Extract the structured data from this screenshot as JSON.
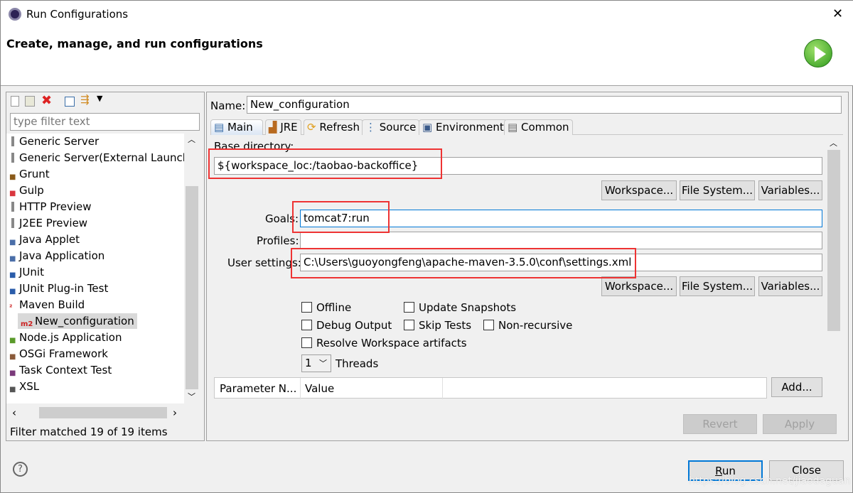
{
  "window": {
    "title": "Run Configurations",
    "close_glyph": "✕"
  },
  "header": {
    "title": "Create, manage, and run configurations"
  },
  "left": {
    "filter_placeholder": "type filter text",
    "items": [
      {
        "label": "Generic Server",
        "icon": "server-icon",
        "color": "#888888"
      },
      {
        "label": "Generic Server(External Launch)",
        "icon": "server-icon",
        "color": "#888888"
      },
      {
        "label": "Grunt",
        "icon": "grunt-icon",
        "color": "#8a5a1a"
      },
      {
        "label": "Gulp",
        "icon": "gulp-icon",
        "color": "#d9363e"
      },
      {
        "label": "HTTP Preview",
        "icon": "server-icon",
        "color": "#888888"
      },
      {
        "label": "J2EE Preview",
        "icon": "server-icon",
        "color": "#888888"
      },
      {
        "label": "Java Applet",
        "icon": "applet-icon",
        "color": "#4a6ea8"
      },
      {
        "label": "Java Application",
        "icon": "java-app-icon",
        "color": "#4a6ea8"
      },
      {
        "label": "JUnit",
        "icon": "junit-icon",
        "color": "#2a5caa"
      },
      {
        "label": "JUnit Plug-in Test",
        "icon": "junit-plugin-icon",
        "color": "#2a5caa"
      },
      {
        "label": "Maven Build",
        "icon": "maven-icon",
        "color": "#cc2222"
      },
      {
        "label": "New_configuration",
        "icon": "maven-icon",
        "color": "#cc2222",
        "child": true,
        "selected": true
      },
      {
        "label": "Node.js Application",
        "icon": "nodejs-icon",
        "color": "#5a9a2a"
      },
      {
        "label": "OSGi Framework",
        "icon": "osgi-icon",
        "color": "#8a5a3a"
      },
      {
        "label": "Task Context Test",
        "icon": "task-icon",
        "color": "#7a3a7a"
      },
      {
        "label": "XSL",
        "icon": "xsl-icon",
        "color": "#555555"
      }
    ],
    "status": "Filter matched 19 of 19 items"
  },
  "form": {
    "name_label": "Name:",
    "name_value": "New_configuration",
    "tabs": [
      "Main",
      "JRE",
      "Refresh",
      "Source",
      "Environment",
      "Common"
    ],
    "base_dir_label": "Base directory:",
    "base_dir_value": "${workspace_loc:/taobao-backoffice}",
    "workspace_btn": "Workspace...",
    "filesystem_btn": "File System...",
    "variables_btn": "Variables...",
    "goals_label": "Goals:",
    "goals_value": "tomcat7:run",
    "profiles_label": "Profiles:",
    "profiles_value": "",
    "user_settings_label": "User settings:",
    "user_settings_value": "C:\\Users\\guoyongfeng\\apache-maven-3.5.0\\conf\\settings.xml",
    "checkboxes": {
      "offline": "Offline",
      "update_snapshots": "Update Snapshots",
      "debug_output": "Debug Output",
      "skip_tests": "Skip Tests",
      "non_recursive": "Non-recursive",
      "resolve_workspace": "Resolve Workspace artifacts"
    },
    "threads_value": "1",
    "threads_label": "Threads",
    "param_col1": "Parameter N...",
    "param_col2": "Value",
    "add_btn": "Add...",
    "revert_btn": "Revert",
    "apply_btn": "Apply"
  },
  "footer": {
    "help": "?",
    "run": "Run",
    "close": "Close",
    "watermark": "https://blog.csdn.net/jiaodaguan"
  },
  "colors": {
    "accent": "#0078d7",
    "highlight": "#ee3333",
    "selected": "#d9d9d9"
  }
}
